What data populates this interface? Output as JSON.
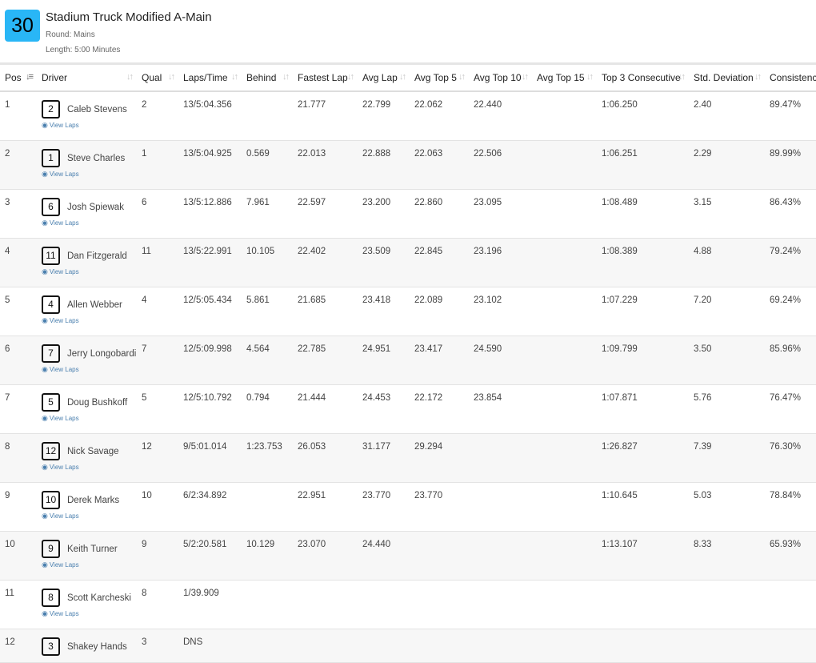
{
  "event": {
    "badge": "30",
    "title": "Stadium Truck Modified A-Main",
    "round": "Round: Mains",
    "length": "Length: 5:00 Minutes"
  },
  "columns": [
    "Pos",
    "Driver",
    "Qual",
    "Laps/Time",
    "Behind",
    "Fastest Lap",
    "Avg Lap",
    "Avg Top 5",
    "Avg Top 10",
    "Avg Top 15",
    "Top 3 Consecutive",
    "Std. Deviation",
    "Consistency"
  ],
  "view_laps_label": "View Laps",
  "rows": [
    {
      "pos": "1",
      "num": "2",
      "driver": "Caleb Stevens",
      "qual": "2",
      "laps": "13/5:04.356",
      "behind": "",
      "fastest": "21.777",
      "avg": "22.799",
      "avg5": "22.062",
      "avg10": "22.440",
      "avg15": "",
      "top3": "1:06.250",
      "std": "2.40",
      "cons": "89.47%"
    },
    {
      "pos": "2",
      "num": "1",
      "driver": "Steve Charles",
      "qual": "1",
      "laps": "13/5:04.925",
      "behind": "0.569",
      "fastest": "22.013",
      "avg": "22.888",
      "avg5": "22.063",
      "avg10": "22.506",
      "avg15": "",
      "top3": "1:06.251",
      "std": "2.29",
      "cons": "89.99%"
    },
    {
      "pos": "3",
      "num": "6",
      "driver": "Josh Spiewak",
      "qual": "6",
      "laps": "13/5:12.886",
      "behind": "7.961",
      "fastest": "22.597",
      "avg": "23.200",
      "avg5": "22.860",
      "avg10": "23.095",
      "avg15": "",
      "top3": "1:08.489",
      "std": "3.15",
      "cons": "86.43%"
    },
    {
      "pos": "4",
      "num": "11",
      "driver": "Dan Fitzgerald",
      "qual": "11",
      "laps": "13/5:22.991",
      "behind": "10.105",
      "fastest": "22.402",
      "avg": "23.509",
      "avg5": "22.845",
      "avg10": "23.196",
      "avg15": "",
      "top3": "1:08.389",
      "std": "4.88",
      "cons": "79.24%"
    },
    {
      "pos": "5",
      "num": "4",
      "driver": "Allen Webber",
      "qual": "4",
      "laps": "12/5:05.434",
      "behind": "5.861",
      "fastest": "21.685",
      "avg": "23.418",
      "avg5": "22.089",
      "avg10": "23.102",
      "avg15": "",
      "top3": "1:07.229",
      "std": "7.20",
      "cons": "69.24%"
    },
    {
      "pos": "6",
      "num": "7",
      "driver": "Jerry Longobardi",
      "qual": "7",
      "laps": "12/5:09.998",
      "behind": "4.564",
      "fastest": "22.785",
      "avg": "24.951",
      "avg5": "23.417",
      "avg10": "24.590",
      "avg15": "",
      "top3": "1:09.799",
      "std": "3.50",
      "cons": "85.96%"
    },
    {
      "pos": "7",
      "num": "5",
      "driver": "Doug Bushkoff",
      "qual": "5",
      "laps": "12/5:10.792",
      "behind": "0.794",
      "fastest": "21.444",
      "avg": "24.453",
      "avg5": "22.172",
      "avg10": "23.854",
      "avg15": "",
      "top3": "1:07.871",
      "std": "5.76",
      "cons": "76.47%"
    },
    {
      "pos": "8",
      "num": "12",
      "driver": "Nick Savage",
      "qual": "12",
      "laps": "9/5:01.014",
      "behind": "1:23.753",
      "fastest": "26.053",
      "avg": "31.177",
      "avg5": "29.294",
      "avg10": "",
      "avg15": "",
      "top3": "1:26.827",
      "std": "7.39",
      "cons": "76.30%"
    },
    {
      "pos": "9",
      "num": "10",
      "driver": "Derek Marks",
      "qual": "10",
      "laps": "6/2:34.892",
      "behind": "",
      "fastest": "22.951",
      "avg": "23.770",
      "avg5": "23.770",
      "avg10": "",
      "avg15": "",
      "top3": "1:10.645",
      "std": "5.03",
      "cons": "78.84%"
    },
    {
      "pos": "10",
      "num": "9",
      "driver": "Keith Turner",
      "qual": "9",
      "laps": "5/2:20.581",
      "behind": "10.129",
      "fastest": "23.070",
      "avg": "24.440",
      "avg5": "",
      "avg10": "",
      "avg15": "",
      "top3": "1:13.107",
      "std": "8.33",
      "cons": "65.93%"
    },
    {
      "pos": "11",
      "num": "8",
      "driver": "Scott Karcheski",
      "qual": "8",
      "laps": "1/39.909",
      "behind": "",
      "fastest": "",
      "avg": "",
      "avg5": "",
      "avg10": "",
      "avg15": "",
      "top3": "",
      "std": "",
      "cons": ""
    },
    {
      "pos": "12",
      "num": "3",
      "driver": "Shakey Hands",
      "qual": "3",
      "laps": "DNS",
      "behind": "",
      "fastest": "",
      "avg": "",
      "avg5": "",
      "avg10": "",
      "avg15": "",
      "top3": "",
      "std": "",
      "cons": ""
    }
  ]
}
